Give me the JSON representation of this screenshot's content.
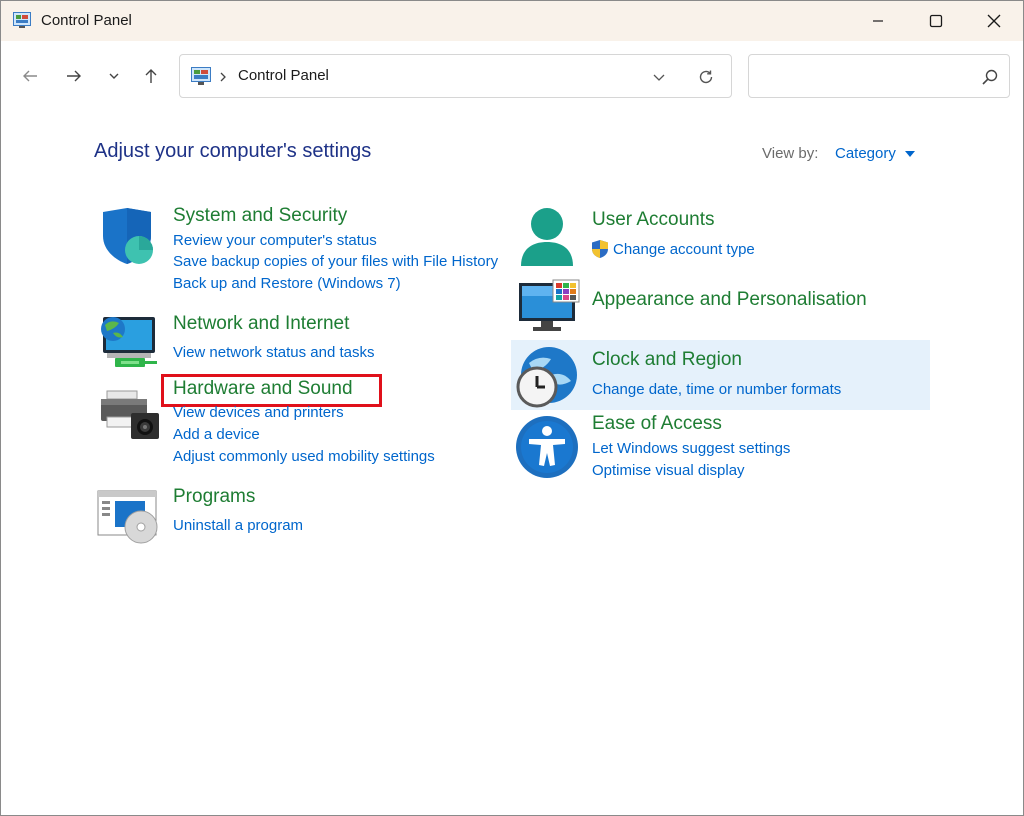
{
  "window": {
    "title": "Control Panel",
    "controls": [
      "minimize-icon",
      "maximize-icon",
      "close-icon"
    ]
  },
  "nav": {
    "icons": [
      "back-arrow-icon",
      "forward-arrow-icon",
      "chevron-down-icon",
      "up-arrow-icon"
    ],
    "address": "Control Panel",
    "search_placeholder": ""
  },
  "content": {
    "heading": "Adjust your computer's settings",
    "view_by_label": "View by:",
    "view_by_value": "Category"
  },
  "categories": {
    "system": {
      "title": "System and Security",
      "links": [
        "Review your computer's status",
        "Save backup copies of your files with File History",
        "Back up and Restore (Windows 7)"
      ]
    },
    "network": {
      "title": "Network and Internet",
      "links": [
        "View network status and tasks"
      ]
    },
    "hardware": {
      "title": "Hardware and Sound",
      "links": [
        "View devices and printers",
        "Add a device",
        "Adjust commonly used mobility settings"
      ]
    },
    "programs": {
      "title": "Programs",
      "links": [
        "Uninstall a program"
      ]
    },
    "users": {
      "title": "User Accounts",
      "links": [
        "Change account type"
      ]
    },
    "appearance": {
      "title": "Appearance and Personalisation",
      "links": []
    },
    "clock": {
      "title": "Clock and Region",
      "links": [
        "Change date, time or number formats"
      ]
    },
    "ease": {
      "title": "Ease of Access",
      "links": [
        "Let Windows suggest settings",
        "Optimise visual display"
      ]
    }
  },
  "colors": {
    "category_title": "#1e7d33",
    "link": "#0066cc",
    "heading": "#1e3287",
    "highlight": "#e0101a",
    "hover": "#e5f1fb"
  }
}
